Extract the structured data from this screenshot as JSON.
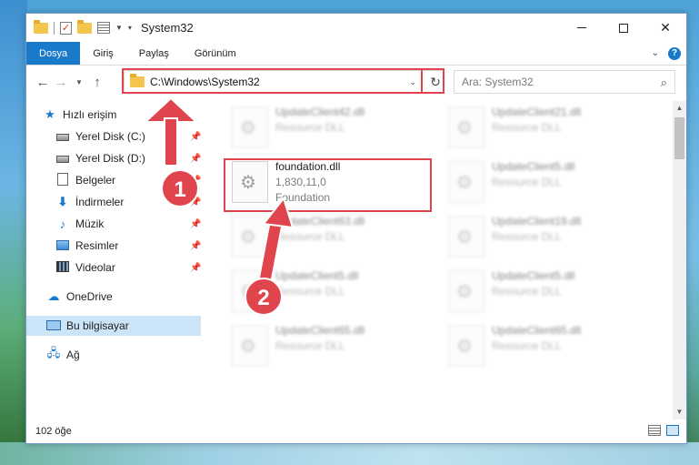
{
  "window": {
    "title": "System32",
    "controls": {
      "minimize": "",
      "maximize": "",
      "close": "✕"
    }
  },
  "ribbon": {
    "tabs": [
      "Dosya",
      "Giriş",
      "Paylaş",
      "Görünüm"
    ]
  },
  "navigation": {
    "back_icon": "arrow-left-icon",
    "forward_icon": "arrow-right-icon",
    "up_icon": "arrow-up-icon",
    "address": "C:\\Windows\\System32",
    "search_placeholder": "Ara: System32"
  },
  "sidebar": {
    "items": [
      {
        "label": "Hızlı erişim",
        "icon": "star-icon",
        "pinned": false
      },
      {
        "label": "Yerel Disk (C:)",
        "icon": "disk-icon",
        "pinned": true
      },
      {
        "label": "Yerel Disk (D:)",
        "icon": "disk-icon",
        "pinned": true
      },
      {
        "label": "Belgeler",
        "icon": "documents-icon",
        "pinned": true
      },
      {
        "label": "İndirmeler",
        "icon": "download-icon",
        "pinned": true
      },
      {
        "label": "Müzik",
        "icon": "music-icon",
        "pinned": true
      },
      {
        "label": "Resimler",
        "icon": "pictures-icon",
        "pinned": true
      },
      {
        "label": "Videolar",
        "icon": "videos-icon",
        "pinned": true
      },
      {
        "label": "OneDrive",
        "icon": "cloud-icon",
        "pinned": false
      },
      {
        "label": "Bu bilgisayar",
        "icon": "computer-icon",
        "pinned": false,
        "selected": true
      },
      {
        "label": "Ağ",
        "icon": "network-icon",
        "pinned": false
      }
    ]
  },
  "files": [
    {
      "name": "UpdateClient42.dll",
      "type": "Resource DLL"
    },
    {
      "name": "UpdateClient21.dll",
      "type": "Resource DLL"
    },
    {
      "name": "foundation.dll",
      "version": "1,830,11,0",
      "type": "Foundation",
      "highlighted": true
    },
    {
      "name": "UpdateClient5.dll",
      "type": "Resource DLL"
    },
    {
      "name": "UpdateClient63.dll",
      "type": "Resource DLL"
    },
    {
      "name": "UpdateClient19.dll",
      "type": "Resource DLL"
    },
    {
      "name": "UpdateClient5.dll",
      "type": "Resource DLL"
    },
    {
      "name": "UpdateClient5.dll",
      "type": "Resource DLL"
    },
    {
      "name": "UpdateClient65.dll",
      "type": "Resource DLL"
    },
    {
      "name": "UpdateClient65.dll",
      "type": "Resource DLL"
    }
  ],
  "status": {
    "item_count": "102 öğe"
  },
  "annotations": {
    "step1": "1",
    "step2": "2",
    "color": "#e0454e"
  }
}
